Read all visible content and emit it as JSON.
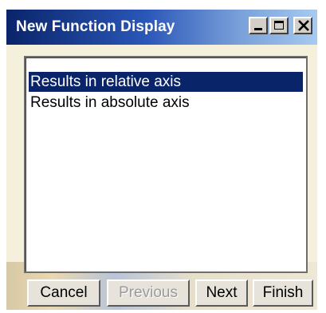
{
  "window": {
    "title": "New Function Display",
    "controls": {
      "minimize_icon": "minimize-icon",
      "maximize_icon": "maximize-icon",
      "close_icon": "close-icon"
    }
  },
  "list": {
    "items": [
      {
        "label": "Results in relative axis",
        "selected": true
      },
      {
        "label": "Results in absolute axis",
        "selected": false
      }
    ]
  },
  "buttons": {
    "cancel": "Cancel",
    "previous": "Previous",
    "next": "Next",
    "finish": "Finish"
  },
  "colors": {
    "titlebar_start": "#0a246a",
    "titlebar_end": "#a6caf0",
    "selection": "#0a246a",
    "dialog_bg": "#f5f0dc"
  }
}
